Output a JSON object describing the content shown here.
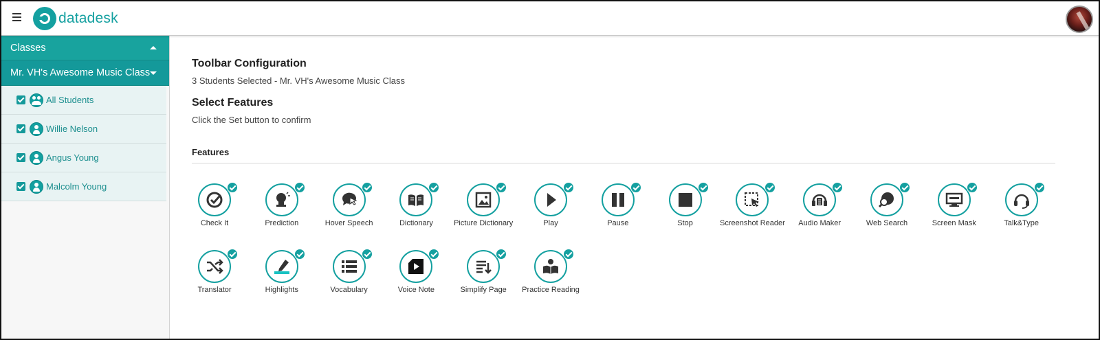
{
  "header": {
    "app_name": "datadesk"
  },
  "sidebar": {
    "classes_label": "Classes",
    "class_name": "Mr. VH's Awesome Music Class",
    "students": [
      {
        "name": "All Students",
        "checked": true
      },
      {
        "name": "Willie Nelson",
        "checked": true
      },
      {
        "name": "Angus Young",
        "checked": true
      },
      {
        "name": "Malcolm Young",
        "checked": true
      }
    ]
  },
  "main": {
    "title": "Toolbar Configuration",
    "subtitle": "3 Students Selected - Mr. VH's Awesome Music Class",
    "select_title": "Select Features",
    "select_subtitle": "Click the Set button to confirm",
    "features_heading": "Features",
    "features": [
      {
        "label": "Check It",
        "icon": "check-it-icon",
        "enabled": true
      },
      {
        "label": "Prediction",
        "icon": "prediction-icon",
        "enabled": true
      },
      {
        "label": "Hover Speech",
        "icon": "hover-speech-icon",
        "enabled": true
      },
      {
        "label": "Dictionary",
        "icon": "dictionary-icon",
        "enabled": true
      },
      {
        "label": "Picture Dictionary",
        "icon": "picture-dictionary-icon",
        "enabled": true
      },
      {
        "label": "Play",
        "icon": "play-icon",
        "enabled": true
      },
      {
        "label": "Pause",
        "icon": "pause-icon",
        "enabled": true
      },
      {
        "label": "Stop",
        "icon": "stop-icon",
        "enabled": true
      },
      {
        "label": "Screenshot Reader",
        "icon": "screenshot-reader-icon",
        "enabled": true
      },
      {
        "label": "Audio Maker",
        "icon": "audio-maker-icon",
        "enabled": true
      },
      {
        "label": "Web Search",
        "icon": "web-search-icon",
        "enabled": true
      },
      {
        "label": "Screen Mask",
        "icon": "screen-mask-icon",
        "enabled": true
      },
      {
        "label": "Talk&Type",
        "icon": "talk-type-icon",
        "enabled": true
      },
      {
        "label": "Translator",
        "icon": "translator-icon",
        "enabled": true
      },
      {
        "label": "Highlights",
        "icon": "highlights-icon",
        "enabled": true
      },
      {
        "label": "Vocabulary",
        "icon": "vocabulary-icon",
        "enabled": true
      },
      {
        "label": "Voice Note",
        "icon": "voice-note-icon",
        "enabled": true
      },
      {
        "label": "Simplify Page",
        "icon": "simplify-page-icon",
        "enabled": true
      },
      {
        "label": "Practice Reading",
        "icon": "practice-reading-icon",
        "enabled": true
      }
    ]
  },
  "colors": {
    "accent": "#14a0a0",
    "sidebar_header": "#18a39e",
    "student_row": "#e8f3f3"
  }
}
